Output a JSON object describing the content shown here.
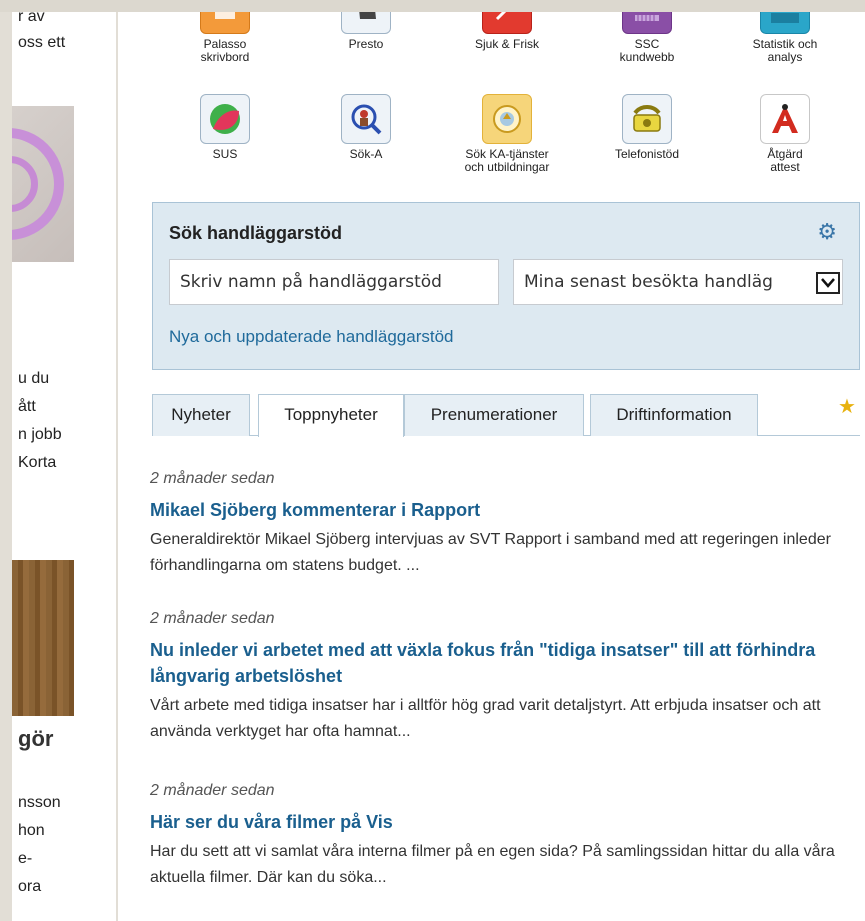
{
  "left_column": {
    "fragments_top": [
      "r av",
      "oss ett"
    ],
    "fragments_mid": [
      "u du",
      "ått",
      "n jobb",
      "Korta"
    ],
    "heading_fragment": "gör",
    "fragments_bottom": [
      "nsson",
      "hon",
      "e-",
      "ora"
    ]
  },
  "apps": [
    {
      "label": "Palasso\nskrivbord",
      "icon": "palasso-icon"
    },
    {
      "label": "Presto",
      "icon": "presto-icon"
    },
    {
      "label": "Sjuk & Frisk",
      "icon": "sjuk-frisk-icon"
    },
    {
      "label": "SSC\nkundwebb",
      "icon": "ssc-icon"
    },
    {
      "label": "Statistik och\nanalys",
      "icon": "statistik-icon"
    },
    {
      "label": "SUS",
      "icon": "sus-icon"
    },
    {
      "label": "Sök-A",
      "icon": "sok-a-icon"
    },
    {
      "label": "Sök KA-tjänster\noch utbildningar",
      "icon": "sok-ka-icon"
    },
    {
      "label": "Telefonistöd",
      "icon": "telephone-icon"
    },
    {
      "label": "Åtgärd\nattest",
      "icon": "atgard-icon"
    }
  ],
  "search": {
    "title": "Sök handläggarstöd",
    "input_placeholder": "Skriv namn på handläggarstöd",
    "select_value": "Mina senast besökta handläg",
    "link": "Nya och uppdaterade handläggarstöd"
  },
  "tabs": [
    "Nyheter",
    "Toppnyheter",
    "Prenumerationer",
    "Driftinformation"
  ],
  "active_tab": "Toppnyheter",
  "news": [
    {
      "when": "2 månader sedan",
      "headline": "Mikael Sjöberg kommenterar i Rapport",
      "summary": "Generaldirektör Mikael Sjöberg intervjuas av SVT Rapport i samband med att regeringen inleder förhandlingarna om statens budget. ..."
    },
    {
      "when": "2 månader sedan",
      "headline": "Nu inleder vi arbetet med att växla fokus från \"tidiga insatser\" till att förhindra långvarig arbetslöshet",
      "summary": "Vårt arbete med tidiga insatser har i alltför hög grad varit detaljstyrt. Att erbjuda insatser och att använda verktyget har ofta hamnat..."
    },
    {
      "when": "2 månader sedan",
      "headline": "Här ser du våra filmer på Vis",
      "summary": "Har du sett att vi samlat våra interna filmer på en egen sida? På samlingssidan hittar du alla våra aktuella filmer. Där kan du söka..."
    }
  ],
  "colors": {
    "accent": "#1a5f8e",
    "panel_bg": "#dde9f1",
    "star": "#e8b20f"
  }
}
